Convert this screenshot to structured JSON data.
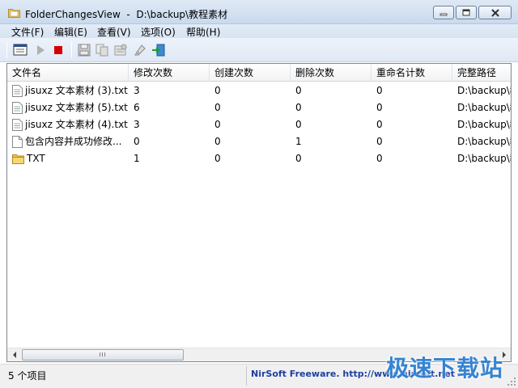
{
  "window": {
    "title": "FolderChangesView  -  D:\\backup\\教程素材"
  },
  "menu": {
    "items": [
      "文件(F)",
      "编辑(E)",
      "查看(V)",
      "选项(O)",
      "帮助(H)"
    ]
  },
  "toolbar": {
    "buttons": [
      "select-folder-icon",
      "play-icon",
      "stop-icon",
      "save-icon",
      "copy-icon",
      "properties-icon",
      "html-report-icon",
      "exit-icon"
    ]
  },
  "table": {
    "columns": [
      "文件名",
      "修改次数",
      "创建次数",
      "删除次数",
      "重命名计数",
      "完整路径"
    ],
    "rows": [
      {
        "name": "jisuxz 文本素材 (3).txt",
        "modified": "3",
        "created": "0",
        "deleted": "0",
        "renamed": "0",
        "path": "D:\\backup\\教",
        "icon": "text-file-icon"
      },
      {
        "name": "jisuxz 文本素材 (5).txt",
        "modified": "6",
        "created": "0",
        "deleted": "0",
        "renamed": "0",
        "path": "D:\\backup\\教",
        "icon": "text-file-icon"
      },
      {
        "name": "jisuxz 文本素材 (4).txt",
        "modified": "3",
        "created": "0",
        "deleted": "0",
        "renamed": "0",
        "path": "D:\\backup\\教",
        "icon": "text-file-icon"
      },
      {
        "name": "包含内容并成功修改...",
        "modified": "0",
        "created": "0",
        "deleted": "1",
        "renamed": "0",
        "path": "D:\\backup\\教",
        "icon": "blank-file-icon"
      },
      {
        "name": "TXT",
        "modified": "1",
        "created": "0",
        "deleted": "0",
        "renamed": "0",
        "path": "D:\\backup\\教",
        "icon": "folder-icon"
      }
    ]
  },
  "scrollbar": {
    "thumb_grip": "III"
  },
  "status": {
    "count": "5 个项目",
    "credit": "NirSoft Freeware.  http://www.nirsoft.net"
  },
  "watermark": {
    "text": "极速下载站"
  },
  "colors": {
    "accent": "#1e3fa0",
    "watermark": "#2d7fd1",
    "stop": "#d40000"
  }
}
